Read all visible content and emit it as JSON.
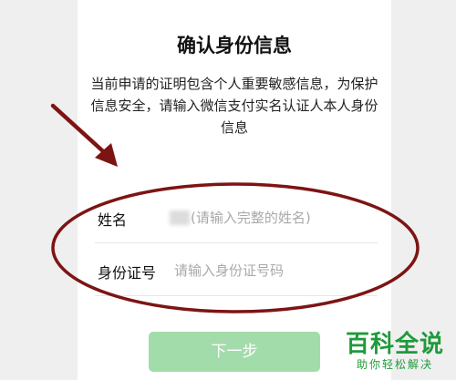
{
  "dialog": {
    "title": "确认身份信息",
    "description": "当前申请的证明包含个人重要敏感信息，为保护信息安全，请输入微信支付实名认证人本人身份信息"
  },
  "form": {
    "name_label": "姓名",
    "name_placeholder": "(请输入完整的姓名)",
    "id_label": "身份证号",
    "id_placeholder": "请输入身份证号码"
  },
  "actions": {
    "next_label": "下一步"
  },
  "watermark": {
    "main": "百科全说",
    "sub": "助你轻松解决"
  },
  "colors": {
    "button_disabled_green": "#a3dcab",
    "annotation_red": "#7d1414",
    "brand_green": "#1f9a3b"
  }
}
